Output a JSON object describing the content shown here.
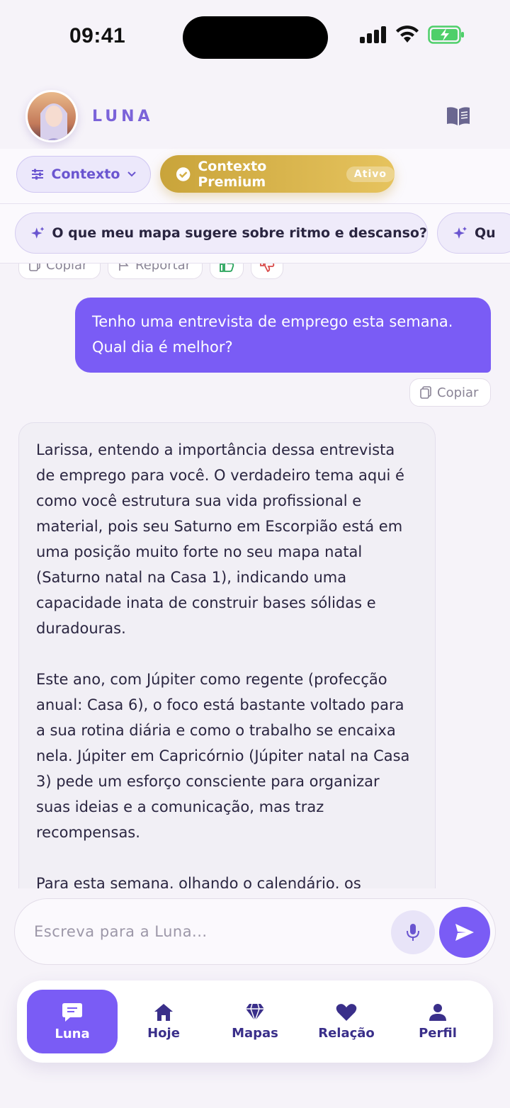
{
  "status_bar": {
    "time": "09:41"
  },
  "header": {
    "brand": "LUNA"
  },
  "context_bar": {
    "contexto_label": "Contexto",
    "premium_label": "Contexto Premium",
    "premium_badge": "Ativo"
  },
  "suggestions": [
    "O que meu mapa sugere sobre ritmo e descanso?",
    "Qu"
  ],
  "actions": {
    "copy": "Copiar",
    "report": "Reportar"
  },
  "messages": {
    "user": "Tenho uma entrevista de emprego esta semana. Qual dia é melhor?",
    "assistant": [
      "Larissa, entendo a importância dessa entrevista de emprego para você. O verdadeiro tema aqui é como você estrutura sua vida profissional e material, pois seu Saturno em Escorpião está em uma posição muito forte no seu mapa natal (Saturno natal na Casa 1), indicando uma capacidade inata de construir bases sólidas e duradouras.",
      "Este ano, com Júpiter como regente (profecção anual: Casa 6), o foco está bastante voltado para a sua rotina diária e como o trabalho se encaixa nela. Júpiter em Capricórnio (Júpiter natal na Casa 3) pede um esforço consciente para organizar suas ideias e a comunicação, mas traz recompensas.",
      "Para esta semana, olhando o calendário, os"
    ]
  },
  "composer": {
    "placeholder": "Escreva para a Luna..."
  },
  "nav": {
    "items": [
      {
        "label": "Luna",
        "icon": "chat-icon",
        "active": true
      },
      {
        "label": "Hoje",
        "icon": "home-icon"
      },
      {
        "label": "Mapas",
        "icon": "diamond-icon"
      },
      {
        "label": "Relação",
        "icon": "heart-icon"
      },
      {
        "label": "Perfil",
        "icon": "user-icon"
      }
    ]
  },
  "colors": {
    "accent": "#7a5cf5",
    "premium": "#d4af45",
    "background": "#f6f3f9"
  }
}
